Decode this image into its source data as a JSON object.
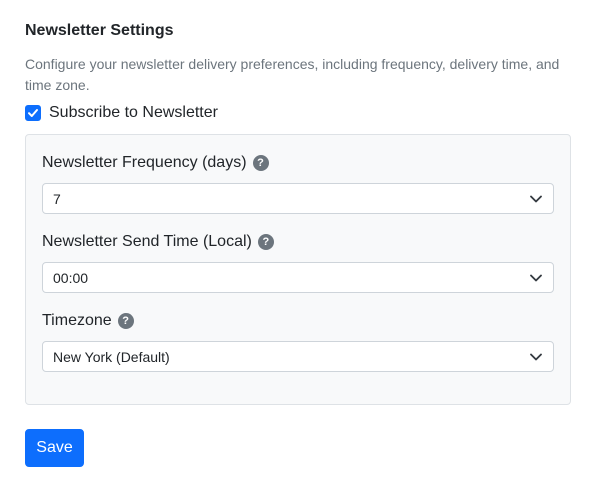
{
  "header": {
    "title": "Newsletter Settings",
    "description": "Configure your newsletter delivery preferences, including frequency, delivery time, and time zone."
  },
  "subscribe": {
    "label": "Subscribe to Newsletter",
    "checked": true
  },
  "fields": {
    "frequency": {
      "label": "Newsletter Frequency (days)",
      "value": "7",
      "help_icon": "question-circle"
    },
    "send_time": {
      "label": "Newsletter Send Time (Local)",
      "value": "00:00",
      "help_icon": "question-circle"
    },
    "timezone": {
      "label": "Timezone",
      "value": "New York (Default)",
      "help_icon": "question-circle"
    }
  },
  "actions": {
    "save_label": "Save"
  },
  "colors": {
    "primary": "#0d6efd",
    "muted_text": "#6c757d",
    "panel_bg": "#f8f9fa",
    "border": "#dee2e6"
  }
}
